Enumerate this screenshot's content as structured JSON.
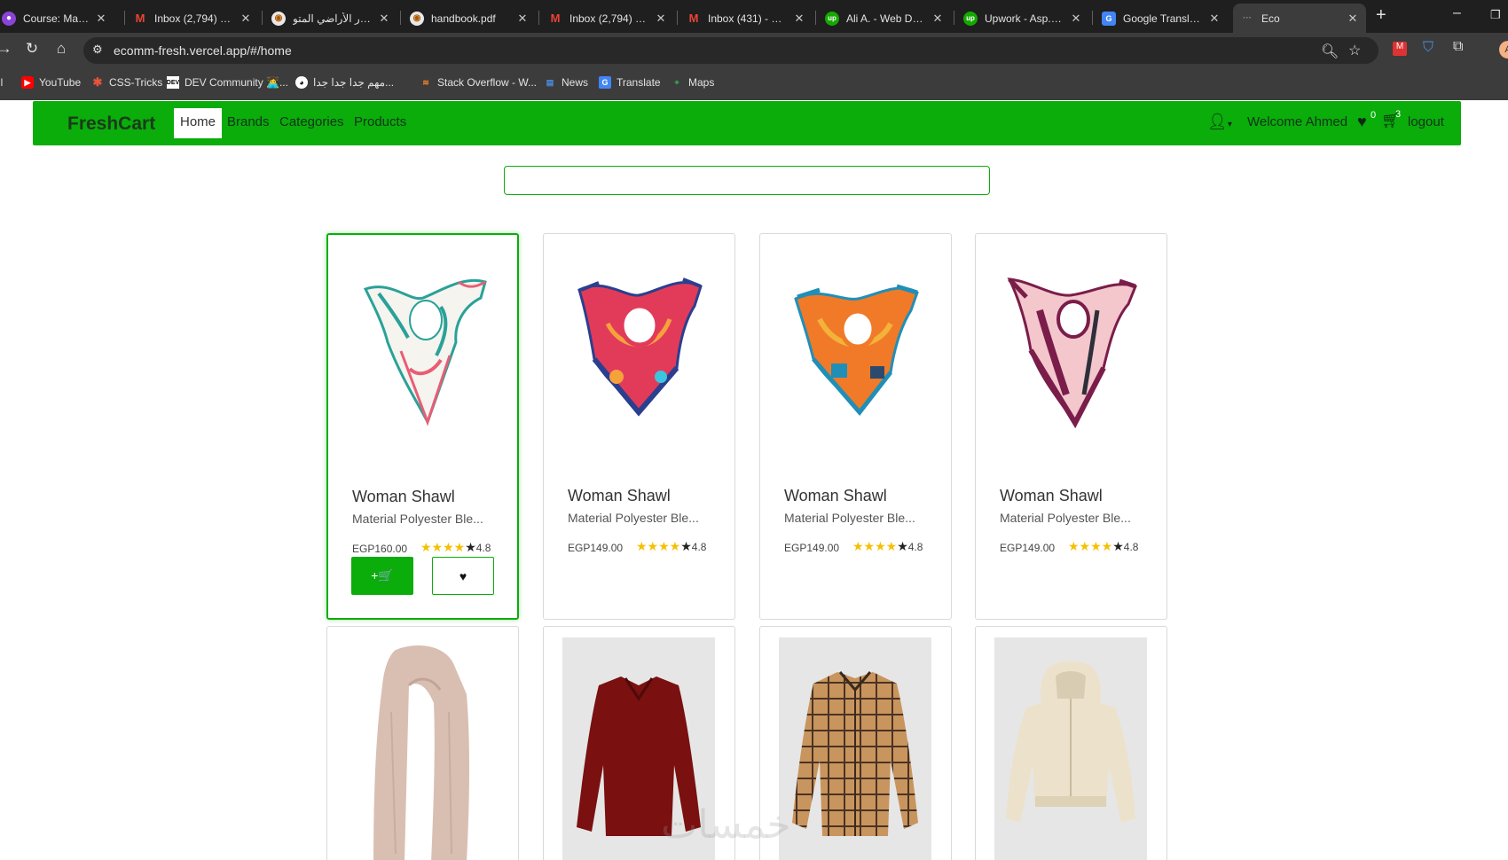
{
  "browser": {
    "tabs": [
      {
        "title": "Course: Master AS",
        "icon": "course-icon"
      },
      {
        "title": "Inbox (2,794) - ali",
        "icon": "gmail-icon"
      },
      {
        "title": "محور الأراضي المتو",
        "icon": "site-icon"
      },
      {
        "title": "handbook.pdf",
        "icon": "pdf-icon"
      },
      {
        "title": "Inbox (2,794) - ali",
        "icon": "gmail-icon"
      },
      {
        "title": "Inbox (431) - aliali",
        "icon": "gmail-icon"
      },
      {
        "title": "Ali A. - Web Deve",
        "icon": "upwork-icon"
      },
      {
        "title": "Upwork - Asp.net",
        "icon": "upwork-icon"
      },
      {
        "title": "Google Translate",
        "icon": "translate-icon"
      },
      {
        "title": "Eco",
        "icon": "blank-icon"
      }
    ],
    "url": "ecomm-fresh.vercel.app/#/home",
    "bookmarks": [
      {
        "label": "il"
      },
      {
        "label": "YouTube"
      },
      {
        "label": "CSS-Tricks"
      },
      {
        "label": "DEV Community 👩‍💻..."
      },
      {
        "label": "مهم جدا جدا جدا..."
      },
      {
        "label": "Stack Overflow - W..."
      },
      {
        "label": "News"
      },
      {
        "label": "Translate"
      },
      {
        "label": "Maps"
      }
    ]
  },
  "navbar": {
    "brand": "FreshCart",
    "links": [
      "Home",
      "Brands",
      "Categories",
      "Products"
    ],
    "active_link": "Home",
    "welcome": "Welcome Ahmed",
    "wishlist_count": "0",
    "cart_count": "3",
    "logout": "logout"
  },
  "search": {
    "value": "",
    "placeholder": ""
  },
  "products": [
    {
      "title": "Woman Shawl",
      "description": "Material Polyester Ble...",
      "price": "EGP160.00",
      "rating": "4.8",
      "colors": [
        "#2aa198",
        "#e85d75",
        "#f4f4f0"
      ]
    },
    {
      "title": "Woman Shawl",
      "description": "Material Polyester Ble...",
      "price": "EGP149.00",
      "rating": "4.8",
      "colors": [
        "#e23b5a",
        "#2b3f8f",
        "#f6a23b"
      ]
    },
    {
      "title": "Woman Shawl",
      "description": "Material Polyester Ble...",
      "price": "EGP149.00",
      "rating": "4.8",
      "colors": [
        "#f07a28",
        "#1f8fb8",
        "#f3b23a"
      ]
    },
    {
      "title": "Woman Shawl",
      "description": "Material Polyester Ble...",
      "price": "EGP149.00",
      "rating": "4.8",
      "colors": [
        "#7a1d4a",
        "#f3c7cc",
        "#2f2f3a"
      ]
    }
  ],
  "products_row2": [
    {
      "kind": "scarf",
      "color": "#d9bfb2"
    },
    {
      "kind": "blouse",
      "color": "#7a1010"
    },
    {
      "kind": "plaid-shirt",
      "color": "#c9955e"
    },
    {
      "kind": "hoodie",
      "color": "#ece2cc"
    }
  ],
  "labels": {
    "add_to_cart": "+🛒",
    "watermark": "خمسات"
  }
}
